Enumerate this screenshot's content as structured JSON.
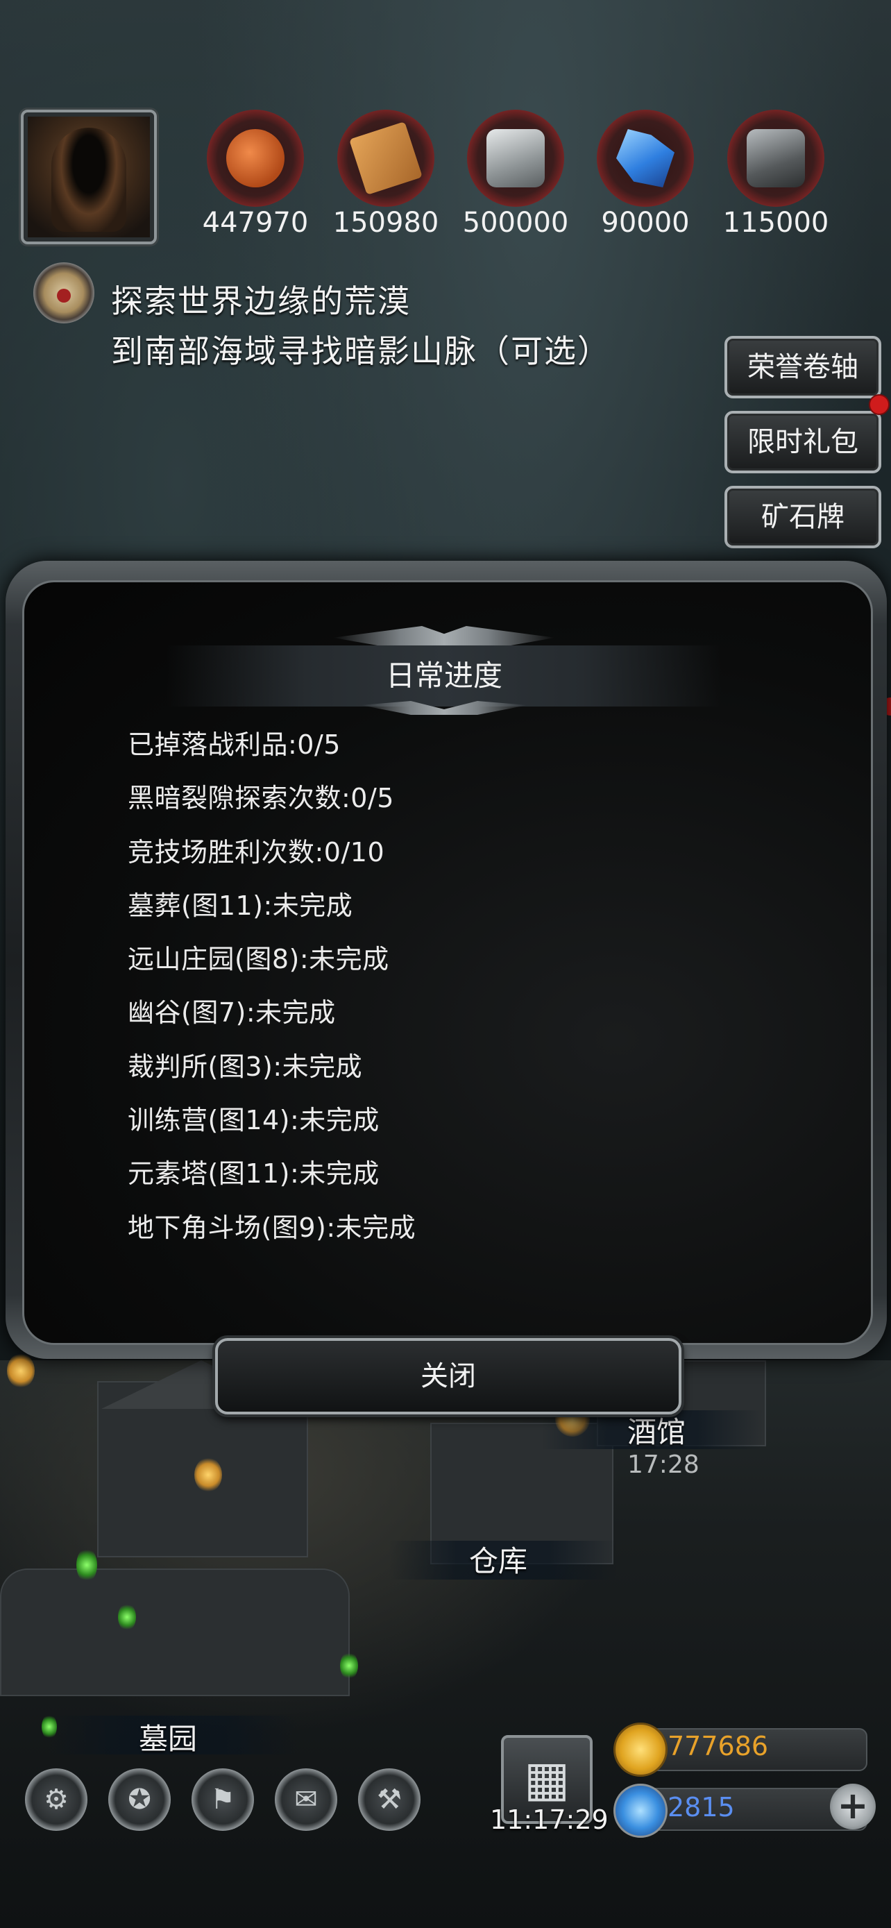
{
  "resources": [
    {
      "name": "wood-meat",
      "value": "447970",
      "color": "#d4672a"
    },
    {
      "name": "plank",
      "value": "150980",
      "color": "#c98a3c"
    },
    {
      "name": "stone",
      "value": "500000",
      "color": "#bfc4c6"
    },
    {
      "name": "crystal",
      "value": "90000",
      "color": "#3f8ce8"
    },
    {
      "name": "iron",
      "value": "115000",
      "color": "#7c8286"
    }
  ],
  "quest": {
    "line1": "探索世界边缘的荒漠",
    "line2": "到南部海域寻找暗影山脉（可选）"
  },
  "side_buttons": {
    "honor_scroll": "荣誉卷轴",
    "limited_pack": "限时礼包",
    "ore_badge": "矿石牌"
  },
  "dialog": {
    "title": "日常进度",
    "items": [
      "已掉落战利品:0/5",
      "黑暗裂隙探索次数:0/5",
      "竞技场胜利次数:0/10",
      "墓葬(图11):未完成",
      "远山庄园(图8):未完成",
      "幽谷(图7):未完成",
      "裁判所(图3):未完成",
      "训练营(图14):未完成",
      "元素塔(图11):未完成",
      "地下角斗场(图9):未完成"
    ],
    "close_label": "关闭"
  },
  "town": {
    "tavern_label": "酒馆",
    "tavern_time": "17:28",
    "warehouse_label": "仓库",
    "graveyard_label": "墓园"
  },
  "bottom": {
    "clock": "11:17:29",
    "gold": "777686",
    "gems": "2815",
    "gold_color": "#e8a22a",
    "gem_color": "#5a8ef0",
    "plus_glyph": "+"
  },
  "icons": {
    "settings": "⚙",
    "achievement": "✪",
    "guild": "⚑",
    "mail": "✉",
    "forge": "⚒",
    "gift": "▦"
  }
}
